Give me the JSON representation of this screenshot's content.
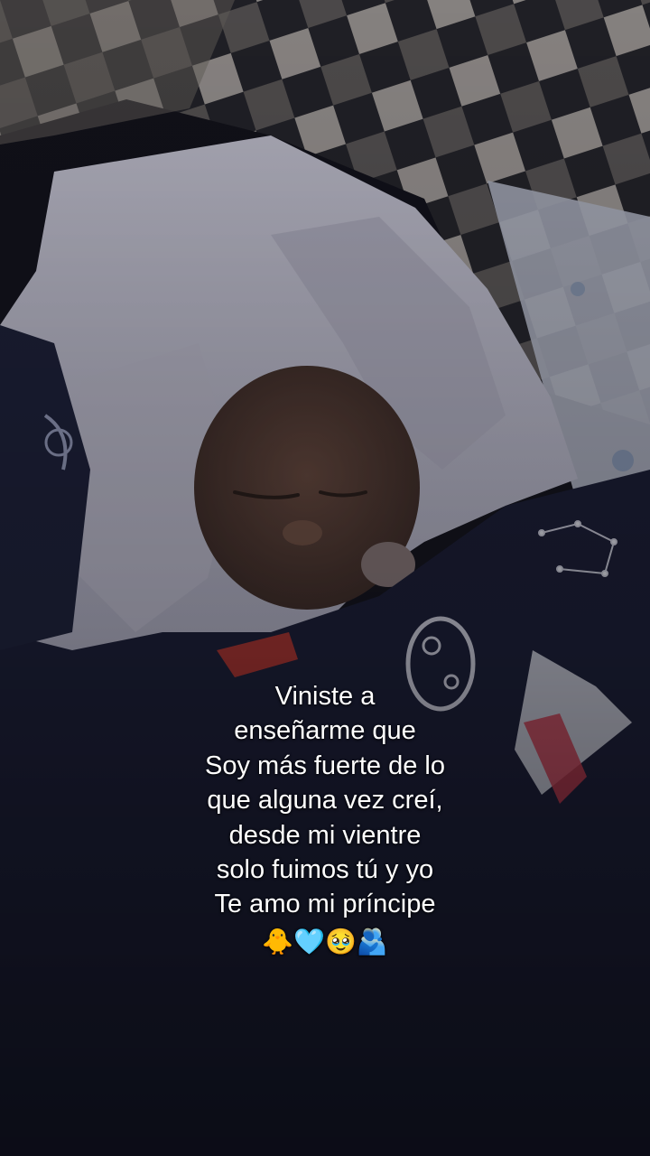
{
  "caption": {
    "lines": [
      "Viniste a",
      "enseñarme que",
      "Soy más fuerte de lo",
      "que alguna vez creí,",
      "desde mi vientre",
      "solo fuimos tú y yo",
      "Te amo mi príncipe"
    ],
    "emoji": "🐥🩵🥹🫂",
    "color": "#ffffff"
  }
}
